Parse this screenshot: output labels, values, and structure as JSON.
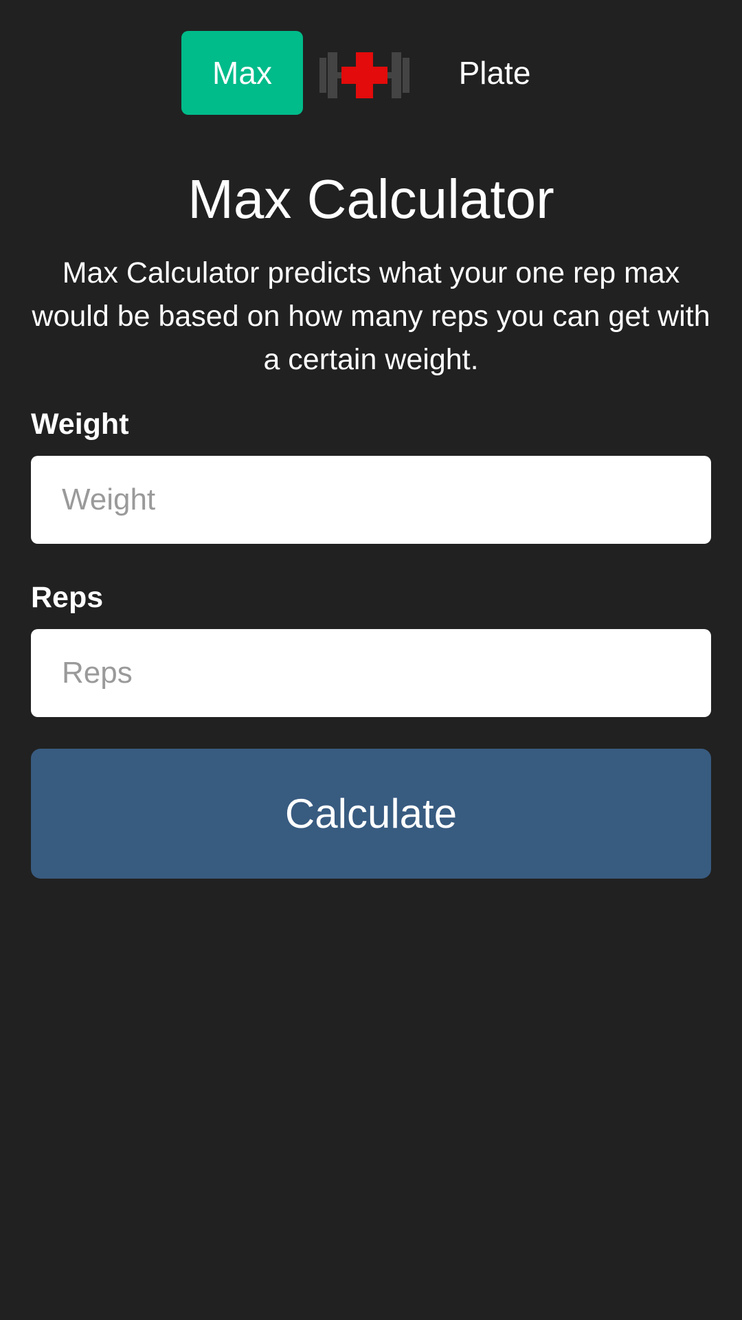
{
  "nav": {
    "max_label": "Max",
    "plate_label": "Plate",
    "logo_icon": "dumbbell-cross-icon",
    "active_tab_color": "#00bb8a"
  },
  "page": {
    "title": "Max Calculator",
    "description": "Max Calculator predicts what your one rep max would be based on how many reps you can get with a certain weight."
  },
  "form": {
    "weight_label": "Weight",
    "weight_placeholder": "Weight",
    "weight_value": "",
    "reps_label": "Reps",
    "reps_placeholder": "Reps",
    "reps_value": "",
    "calculate_label": "Calculate",
    "button_color": "#385b80"
  },
  "colors": {
    "background": "#212121",
    "logo_cross": "#e30b0b",
    "logo_weights": "#444444"
  }
}
